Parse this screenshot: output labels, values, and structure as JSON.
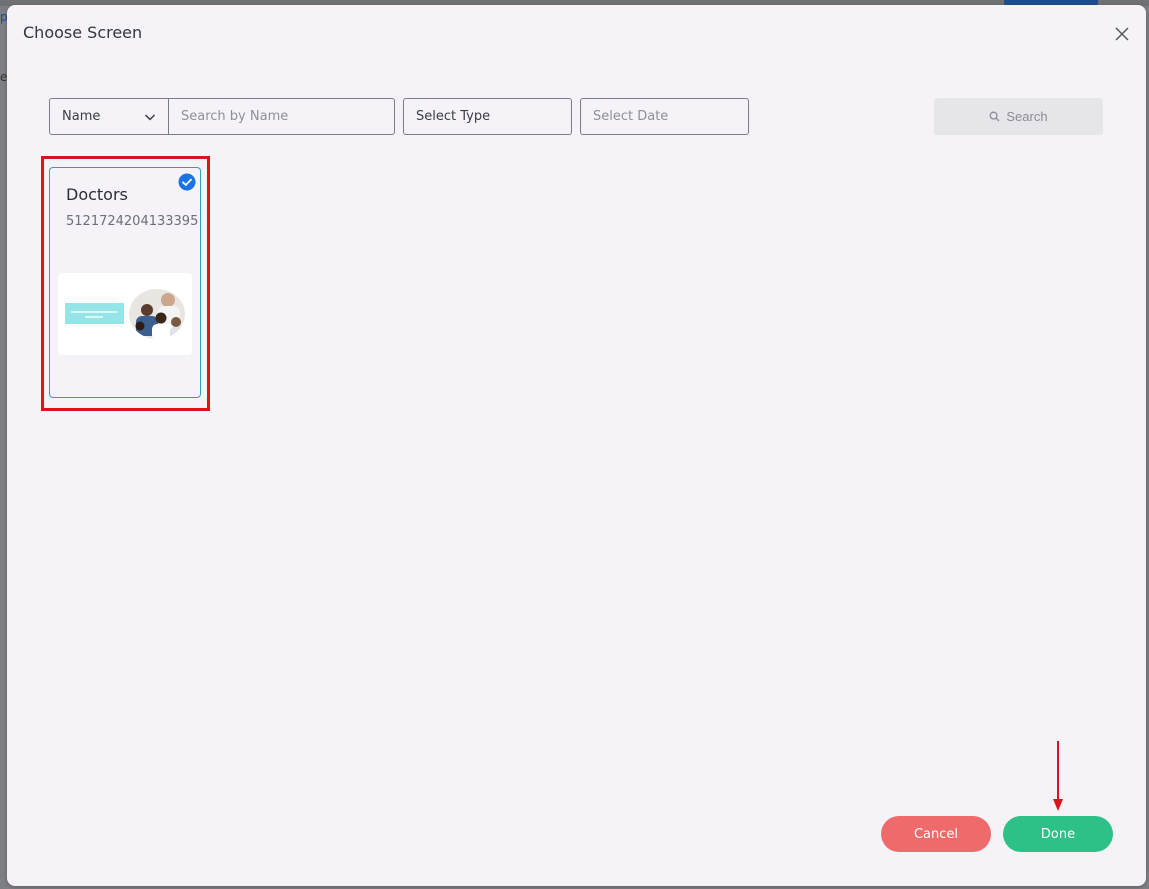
{
  "background": {
    "left_text_a": "p",
    "left_text_b": "e"
  },
  "modal": {
    "title": "Choose Screen",
    "close_icon": "close-icon"
  },
  "filters": {
    "name_select": {
      "value": "Name",
      "icon": "chevron-down-icon"
    },
    "search_name": {
      "placeholder": "Search by Name",
      "value": ""
    },
    "select_type": {
      "value": "Select Type"
    },
    "select_date": {
      "placeholder": "Select Date"
    },
    "search_button": {
      "label": "Search",
      "icon": "search-icon"
    }
  },
  "screens": [
    {
      "title": "Doctors",
      "id": "5121724204133395",
      "selected": true,
      "check_icon": "check-circle-icon"
    }
  ],
  "footer": {
    "cancel_label": "Cancel",
    "done_label": "Done"
  },
  "colors": {
    "accent_blue": "#1a73e8",
    "card_border": "#2e9fc4",
    "highlight_red": "#d9141c",
    "cancel": "#ef6b6b",
    "done": "#2dc087"
  }
}
